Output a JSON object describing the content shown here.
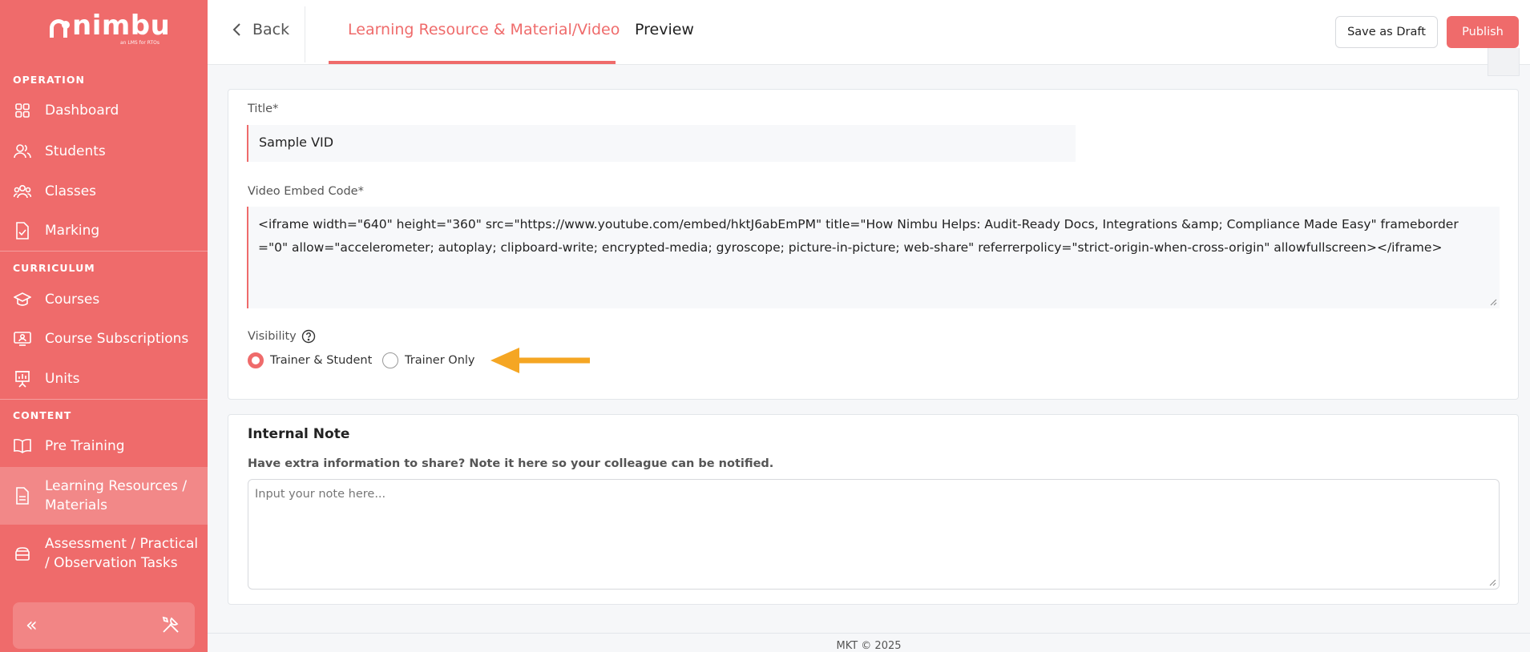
{
  "brand": {
    "name": "nimbu",
    "tagline": "an LMS for RTOs"
  },
  "sidebar": {
    "sections": [
      {
        "label": "OPERATION"
      },
      {
        "label": "CURRICULUM"
      },
      {
        "label": "CONTENT"
      }
    ],
    "items": [
      {
        "label": "Dashboard",
        "icon": "grid-icon"
      },
      {
        "label": "Students",
        "icon": "users-icon"
      },
      {
        "label": "Classes",
        "icon": "group-icon"
      },
      {
        "label": "Marking",
        "icon": "document-check-icon"
      },
      {
        "label": "Courses",
        "icon": "graduation-cap-icon"
      },
      {
        "label": "Course Subscriptions",
        "icon": "monitor-user-icon"
      },
      {
        "label": "Units",
        "icon": "presentation-chart-icon"
      },
      {
        "label": "Pre Training",
        "icon": "book-open-icon"
      },
      {
        "label": "Learning Resources / Materials",
        "icon": "file-icon",
        "active": true
      },
      {
        "label": "Assessment / Practical / Observation Tasks",
        "icon": "layers-icon"
      }
    ],
    "collapse_glyph": "«"
  },
  "header": {
    "back_label": "Back",
    "tabs": [
      {
        "label": "Learning Resource & Material/Video",
        "active": true
      },
      {
        "label": "Preview",
        "active": false
      }
    ],
    "save_draft_label": "Save as Draft",
    "publish_label": "Publish"
  },
  "form": {
    "title_label": "Title*",
    "title_value": "Sample VID",
    "embed_label": "Video Embed Code*",
    "embed_value": "<iframe width=\"640\" height=\"360\" src=\"https://www.youtube.com/embed/hktJ6abEmPM\" title=\"How Nimbu Helps: Audit-Ready Docs, Integrations &amp; Compliance Made Easy\" frameborder=\"0\" allow=\"accelerometer; autoplay; clipboard-write; encrypted-media; gyroscope; picture-in-picture; web-share\" referrerpolicy=\"strict-origin-when-cross-origin\" allowfullscreen></iframe>",
    "visibility_label": "Visibility",
    "visibility_options": [
      {
        "label": "Trainer & Student",
        "selected": true
      },
      {
        "label": "Trainer Only",
        "selected": false
      }
    ]
  },
  "note": {
    "title": "Internal Note",
    "help": "Have extra information to share? Note it here so your colleague can be notified.",
    "placeholder": "Input your note here..."
  },
  "footer": {
    "text": "MKT © 2025"
  },
  "colors": {
    "brand": "#ef6b6b",
    "arrow": "#f5a623"
  }
}
